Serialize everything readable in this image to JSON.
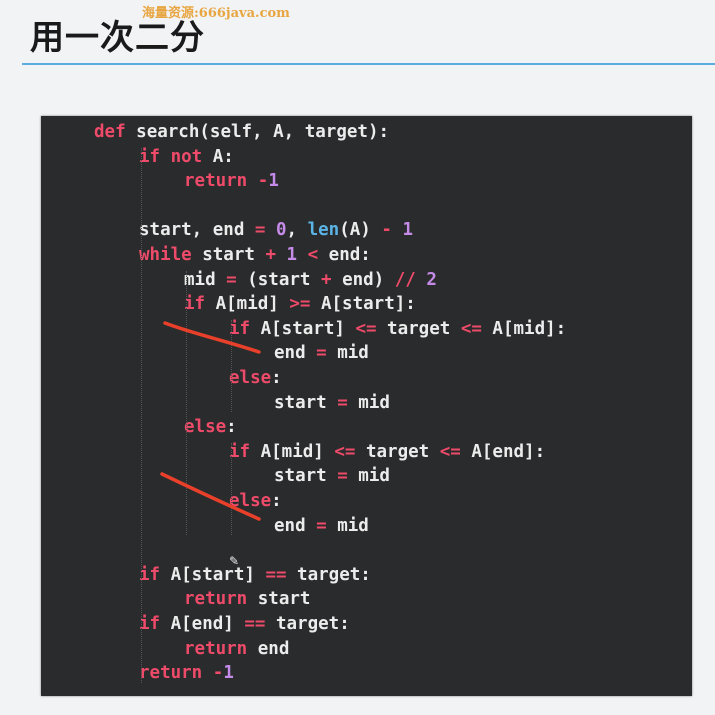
{
  "slide": {
    "title": "用一次二分",
    "watermark": "海量资源:666java.com"
  },
  "code": {
    "lines": [
      {
        "indent": 1,
        "tokens": [
          [
            "kw",
            "def "
          ],
          [
            "tx",
            "search(self, A, target):"
          ]
        ]
      },
      {
        "indent": 2,
        "tokens": [
          [
            "kw",
            "if "
          ],
          [
            "kw",
            "not "
          ],
          [
            "tx",
            "A:"
          ]
        ]
      },
      {
        "indent": 3,
        "tokens": [
          [
            "kw",
            "return "
          ],
          [
            "op",
            "-"
          ],
          [
            "num",
            "1"
          ]
        ]
      },
      {
        "indent": 0,
        "tokens": []
      },
      {
        "indent": 2,
        "tokens": [
          [
            "tx",
            "start, end "
          ],
          [
            "op",
            "= "
          ],
          [
            "num",
            "0"
          ],
          [
            "tx",
            ", "
          ],
          [
            "bi",
            "len"
          ],
          [
            "tx",
            "(A) "
          ],
          [
            "op",
            "- "
          ],
          [
            "num",
            "1"
          ]
        ]
      },
      {
        "indent": 2,
        "tokens": [
          [
            "kw",
            "while "
          ],
          [
            "tx",
            "start "
          ],
          [
            "op",
            "+ "
          ],
          [
            "num",
            "1 "
          ],
          [
            "op",
            "< "
          ],
          [
            "tx",
            "end:"
          ]
        ]
      },
      {
        "indent": 3,
        "tokens": [
          [
            "tx",
            "mid "
          ],
          [
            "op",
            "= "
          ],
          [
            "tx",
            "(start "
          ],
          [
            "op",
            "+ "
          ],
          [
            "tx",
            "end) "
          ],
          [
            "op",
            "// "
          ],
          [
            "num",
            "2"
          ]
        ]
      },
      {
        "indent": 3,
        "tokens": [
          [
            "kw",
            "if "
          ],
          [
            "tx",
            "A[mid] "
          ],
          [
            "op",
            ">= "
          ],
          [
            "tx",
            "A[start]:"
          ]
        ]
      },
      {
        "indent": 4,
        "tokens": [
          [
            "kw",
            "if "
          ],
          [
            "tx",
            "A[start] "
          ],
          [
            "op",
            "<= "
          ],
          [
            "tx",
            "target "
          ],
          [
            "op",
            "<= "
          ],
          [
            "tx",
            "A[mid]:"
          ]
        ]
      },
      {
        "indent": 5,
        "tokens": [
          [
            "tx",
            "end "
          ],
          [
            "op",
            "= "
          ],
          [
            "tx",
            "mid"
          ]
        ]
      },
      {
        "indent": 4,
        "tokens": [
          [
            "kw",
            "else"
          ],
          [
            "tx",
            ":"
          ]
        ]
      },
      {
        "indent": 5,
        "tokens": [
          [
            "tx",
            "start "
          ],
          [
            "op",
            "= "
          ],
          [
            "tx",
            "mid"
          ]
        ]
      },
      {
        "indent": 3,
        "tokens": [
          [
            "kw",
            "else"
          ],
          [
            "tx",
            ":"
          ]
        ]
      },
      {
        "indent": 4,
        "tokens": [
          [
            "kw",
            "if "
          ],
          [
            "tx",
            "A[mid] "
          ],
          [
            "op",
            "<= "
          ],
          [
            "tx",
            "target "
          ],
          [
            "op",
            "<= "
          ],
          [
            "tx",
            "A[end]:"
          ]
        ]
      },
      {
        "indent": 5,
        "tokens": [
          [
            "tx",
            "start "
          ],
          [
            "op",
            "= "
          ],
          [
            "tx",
            "mid"
          ]
        ]
      },
      {
        "indent": 4,
        "tokens": [
          [
            "kw",
            "else"
          ],
          [
            "tx",
            ":"
          ]
        ]
      },
      {
        "indent": 5,
        "tokens": [
          [
            "tx",
            "end "
          ],
          [
            "op",
            "= "
          ],
          [
            "tx",
            "mid"
          ]
        ]
      },
      {
        "indent": 0,
        "tokens": []
      },
      {
        "indent": 2,
        "tokens": [
          [
            "kw",
            "if "
          ],
          [
            "tx",
            "A[start] "
          ],
          [
            "op",
            "== "
          ],
          [
            "tx",
            "target:"
          ]
        ]
      },
      {
        "indent": 3,
        "tokens": [
          [
            "kw",
            "return "
          ],
          [
            "tx",
            "start"
          ]
        ]
      },
      {
        "indent": 2,
        "tokens": [
          [
            "kw",
            "if "
          ],
          [
            "tx",
            "A[end] "
          ],
          [
            "op",
            "== "
          ],
          [
            "tx",
            "target:"
          ]
        ]
      },
      {
        "indent": 3,
        "tokens": [
          [
            "kw",
            "return "
          ],
          [
            "tx",
            "end"
          ]
        ]
      },
      {
        "indent": 2,
        "tokens": [
          [
            "kw",
            "return "
          ],
          [
            "op",
            "-"
          ],
          [
            "num",
            "1"
          ]
        ]
      }
    ]
  },
  "colors": {
    "keyword": "#ee4b6a",
    "number": "#c58be8",
    "builtin": "#5ab4e6",
    "text": "#ececec",
    "panel": "#2a2b2c",
    "title_rule": "#5aaee0",
    "annotation_ink": "#e8402a"
  },
  "annotations": [
    "red-ink-stroke",
    "red-ink-stroke"
  ],
  "cursor": "pen-cursor-icon"
}
